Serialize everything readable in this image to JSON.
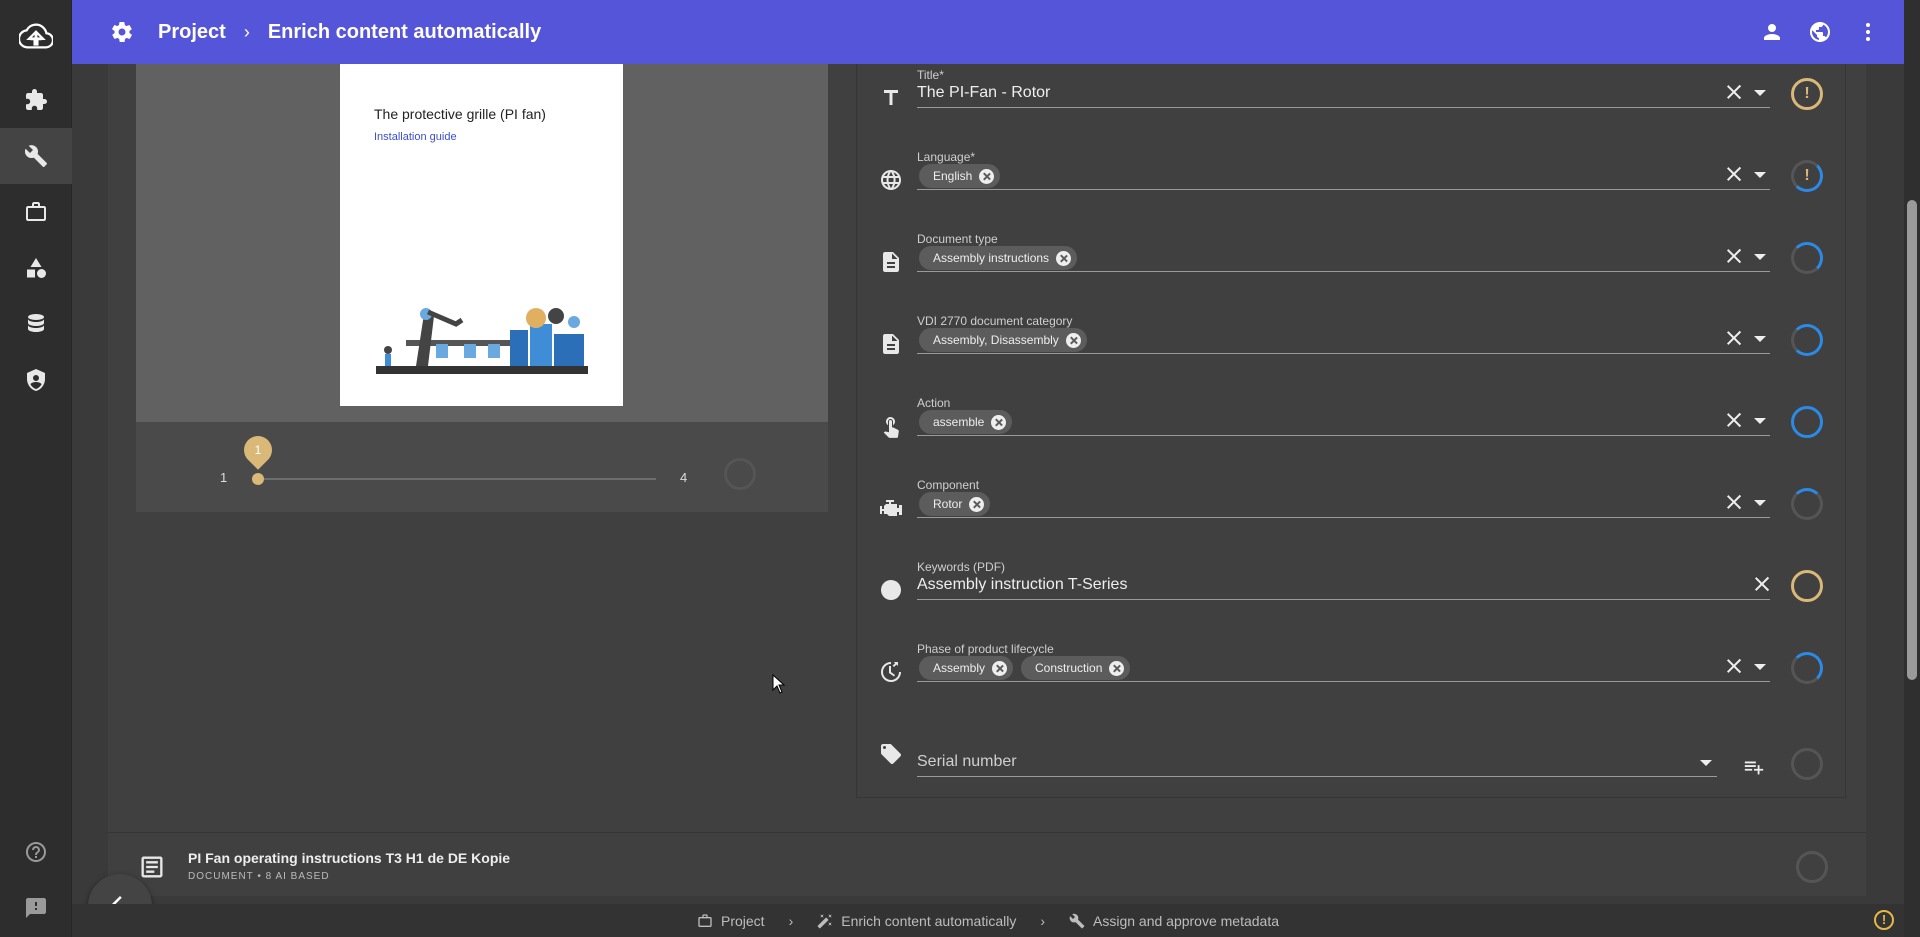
{
  "header": {
    "breadcrumb": [
      "Project",
      "Enrich content automatically"
    ],
    "separator": "›"
  },
  "preview": {
    "page_title": "The protective grille (PI fan)",
    "page_subtitle": "Installation guide",
    "slider": {
      "min": "1",
      "max": "4",
      "current": "1"
    }
  },
  "form": {
    "fields": [
      {
        "label": "Title*",
        "value": "The PI-Fan - Rotor",
        "icon": "text-icon",
        "status": "warning"
      },
      {
        "label": "Language*",
        "chips": [
          "English"
        ],
        "icon": "globe-icon",
        "status": "warning-loading"
      },
      {
        "label": "Document type",
        "chips": [
          "Assembly instructions"
        ],
        "icon": "document-icon",
        "status": "loading"
      },
      {
        "label": "VDI 2770 document category",
        "chips": [
          "Assembly, Disassembly"
        ],
        "icon": "document-icon",
        "status": "loading"
      },
      {
        "label": "Action",
        "chips": [
          "assemble"
        ],
        "icon": "touch-icon",
        "status": "loading"
      },
      {
        "label": "Component",
        "chips": [
          "Rotor"
        ],
        "icon": "engine-icon",
        "status": "loading"
      },
      {
        "label": "Keywords (PDF)",
        "value": "Assembly instruction T-Series",
        "icon": "circle-icon",
        "status": "done"
      },
      {
        "label": "Phase of product lifecycle",
        "chips": [
          "Assembly",
          "Construction"
        ],
        "icon": "lifecycle-icon",
        "status": "loading"
      },
      {
        "placeholder": "Serial number",
        "icon": "tag-icon",
        "status": "idle"
      }
    ]
  },
  "document_row": {
    "title": "PI Fan operating instructions T3 H1 de DE Kopie",
    "meta": "DOCUMENT • 8 AI BASED"
  },
  "bottombar": {
    "items": [
      "Project",
      "Enrich content automatically",
      "Assign and approve metadata"
    ],
    "separator": "›",
    "warning": "!"
  },
  "colors": {
    "accent": "#5555d9",
    "status_warning": "#d9b878",
    "status_loading": "#2b8ae6"
  }
}
